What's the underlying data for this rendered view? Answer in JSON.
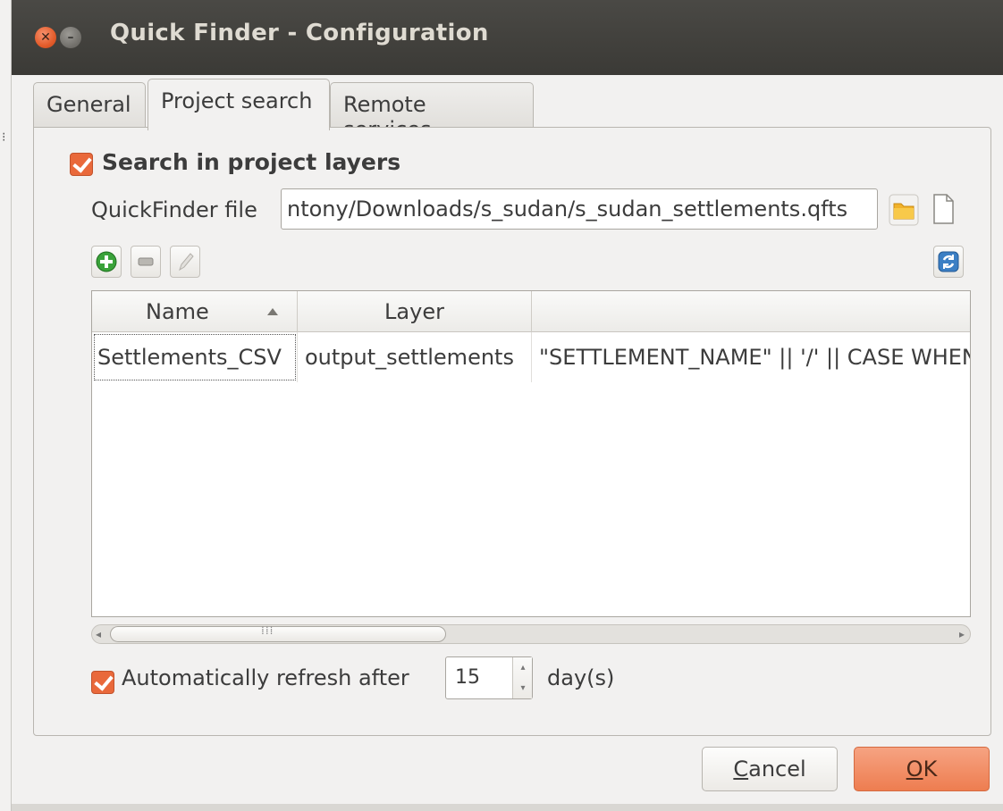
{
  "window": {
    "title": "Quick Finder - Configuration"
  },
  "tabs": [
    {
      "label": "General",
      "active": false
    },
    {
      "label": "Project search",
      "active": true
    },
    {
      "label": "Remote services",
      "active": false
    }
  ],
  "project_search": {
    "search_checkbox": {
      "label": "Search in project layers",
      "checked": true
    },
    "file_label": "QuickFinder file",
    "file_value": "ntony/Downloads/s_sudan/s_sudan_settlements.qfts",
    "table": {
      "columns": [
        "Name",
        "Layer",
        ""
      ],
      "rows": [
        {
          "name": "Settlements_CSV",
          "layer": "output_settlements",
          "expression": "\"SETTLEMENT_NAME\"   || '/'  || CASE WHEN"
        }
      ]
    },
    "refresh": {
      "label": "Automatically refresh after",
      "checked": true,
      "value": "15",
      "unit": "day(s)"
    }
  },
  "buttons": {
    "cancel_pre": "",
    "cancel_u": "C",
    "cancel_post": "ancel",
    "ok_u": "O",
    "ok_post": "K"
  },
  "colors": {
    "accent": "#e9693b",
    "titlebar": "#3b3a36"
  }
}
